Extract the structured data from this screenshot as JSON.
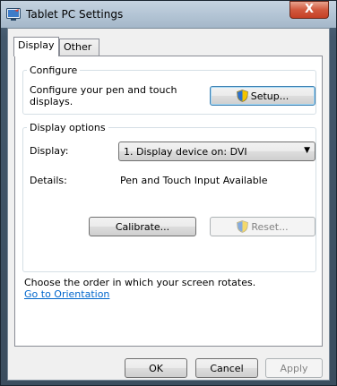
{
  "window": {
    "title": "Tablet PC Settings",
    "close_label": "X"
  },
  "tabs": [
    {
      "label": "Display",
      "active": true
    },
    {
      "label": "Other",
      "active": false
    }
  ],
  "configure": {
    "legend": "Configure",
    "description": "Configure your pen and touch displays.",
    "setup_label": "Setup..."
  },
  "display_options": {
    "legend": "Display options",
    "display_label": "Display:",
    "display_value": "1. Display device on: DVI",
    "details_label": "Details:",
    "details_value": "Pen and Touch Input Available",
    "calibrate_label": "Calibrate...",
    "reset_label": "Reset..."
  },
  "orientation": {
    "text": "Choose the order in which your screen rotates.",
    "link": "Go to Orientation"
  },
  "footer": {
    "ok_label": "OK",
    "cancel_label": "Cancel",
    "apply_label": "Apply"
  },
  "colors": {
    "link": "#0066cc",
    "close": "#c33a1f"
  },
  "icons": {
    "app": "tablet-pc-icon",
    "uac": "uac-shield-icon",
    "dropdown": "chevron-down-icon"
  }
}
